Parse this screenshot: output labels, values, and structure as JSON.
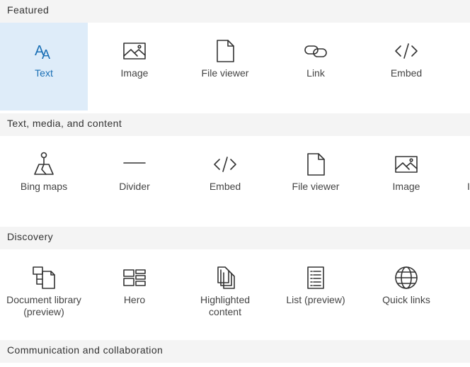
{
  "sections": [
    {
      "title": "Featured",
      "items": [
        {
          "label": "Text",
          "icon": "text-icon",
          "selected": true
        },
        {
          "label": "Image",
          "icon": "image-icon"
        },
        {
          "label": "File viewer",
          "icon": "file-icon"
        },
        {
          "label": "Link",
          "icon": "link-icon"
        },
        {
          "label": "Embed",
          "icon": "code-icon"
        }
      ]
    },
    {
      "title": "Text, media, and content",
      "items": [
        {
          "label": "Bing maps",
          "icon": "map-pin-icon"
        },
        {
          "label": "Divider",
          "icon": "divider-icon"
        },
        {
          "label": "Embed",
          "icon": "code-icon"
        },
        {
          "label": "File viewer",
          "icon": "file-icon"
        },
        {
          "label": "Image",
          "icon": "image-icon"
        },
        {
          "label": "I",
          "icon": ""
        }
      ]
    },
    {
      "title": "Discovery",
      "items": [
        {
          "label": "Document library\n(preview)",
          "icon": "document-library-icon"
        },
        {
          "label": "Hero",
          "icon": "hero-layout-icon"
        },
        {
          "label": "Highlighted\ncontent",
          "icon": "highlighted-content-icon"
        },
        {
          "label": "List (preview)",
          "icon": "list-icon"
        },
        {
          "label": "Quick links",
          "icon": "globe-icon"
        }
      ]
    },
    {
      "title": "Communication and collaboration",
      "items": []
    }
  ],
  "colors": {
    "accent": "#1a6fb5",
    "selected_bg": "#deecf9",
    "header_bg": "#f4f4f4"
  }
}
